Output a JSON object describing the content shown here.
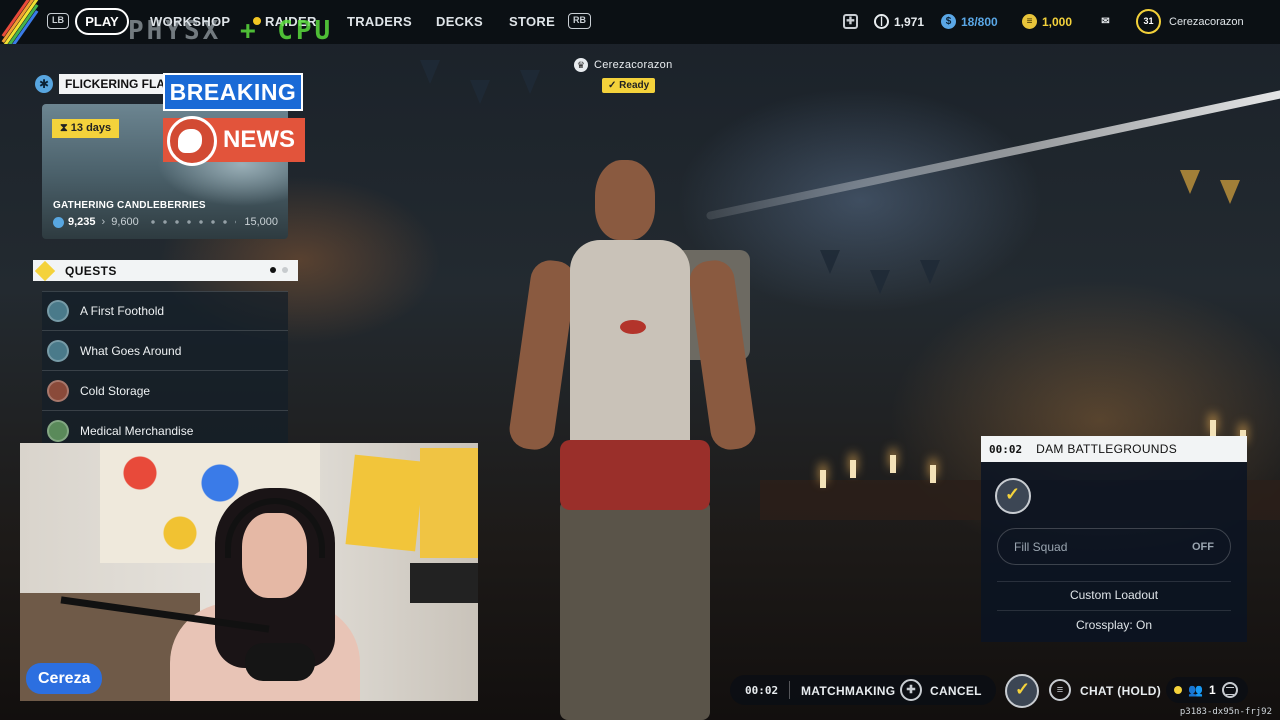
{
  "topbar": {
    "bumper_left": "LB",
    "bumper_right": "RB",
    "nav": [
      "PLAY",
      "WORKSHOP",
      "RAIDER",
      "TRADERS",
      "DECKS",
      "STORE"
    ],
    "physx_overlay_left": "PHYSX",
    "physx_overlay_right": "+ CPU",
    "currency_coins": "1,971",
    "currency_blue": "18/800",
    "currency_gold": "1,000",
    "level": "31",
    "username": "Cerezacorazon"
  },
  "squad": {
    "leader_name": "Cerezacorazon",
    "status": "Ready"
  },
  "event": {
    "title": "FLICKERING FLA",
    "days_left": "13 days",
    "subtitle": "GATHERING CANDLEBERRIES",
    "progress_current": "9,235",
    "progress_next": "9,600",
    "progress_max": "15,000"
  },
  "breaking_news": {
    "line1": "BREAKING",
    "line2": "NEWS"
  },
  "quests": {
    "header": "QUESTS",
    "items": [
      {
        "label": "A First Foothold"
      },
      {
        "label": "What Goes Around"
      },
      {
        "label": "Cold Storage"
      },
      {
        "label": "Medical Merchandise"
      }
    ]
  },
  "webcam": {
    "streamer_name": "Cereza"
  },
  "matchmaking_panel": {
    "timer": "00:02",
    "map": "DAM BATTLEGROUNDS",
    "fill_squad_label": "Fill Squad",
    "fill_squad_value": "OFF",
    "custom_loadout": "Custom Loadout",
    "crossplay": "Crossplay: On"
  },
  "bottom_bar": {
    "timer": "00:02",
    "matchmaking": "MATCHMAKING",
    "cancel": "CANCEL",
    "chat": "CHAT (HOLD)",
    "party_count": "1"
  },
  "build_id": "p3183-dx95n-frj92",
  "colors": {
    "accent_yellow": "#f4d23b",
    "news_blue": "#1a6ad6",
    "news_red": "#e2543b",
    "streamer_tag": "#2c6fe0"
  }
}
